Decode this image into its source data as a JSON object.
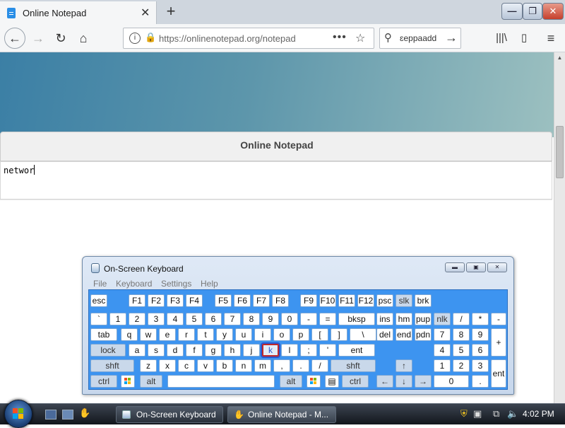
{
  "browser": {
    "tab_title": "Online Notepad",
    "tab_close": "✕",
    "new_tab": "+",
    "window_controls": {
      "minimize": "—",
      "maximize": "❐",
      "close": "✕"
    },
    "nav": {
      "back": "←",
      "forward": "→",
      "reload": "↻",
      "home": "⌂"
    },
    "url": "https://onlinenotepad.org/notepad",
    "url_info": "i",
    "url_lock": "🔒",
    "url_more": "•••",
    "url_star": "☆",
    "search_text": "ɛeppaadd",
    "search_icon": "⚲",
    "search_go": "→",
    "library": "|||\\",
    "sidebar_toggle": "▯",
    "menu": "≡"
  },
  "page": {
    "card_title": "Online Notepad",
    "editor_text": "networ"
  },
  "osk": {
    "title": "On-Screen Keyboard",
    "menu": [
      "File",
      "Keyboard",
      "Settings",
      "Help"
    ],
    "controls": {
      "minimize": "▬",
      "restore": "▣",
      "close": "✕"
    },
    "pressed_key": "k",
    "keys": [
      {
        "label": "esc",
        "special": false
      },
      {
        "label": "F1",
        "special": false
      },
      {
        "label": "F2",
        "special": false
      },
      {
        "label": "F3",
        "special": false
      },
      {
        "label": "F4",
        "special": false
      },
      {
        "label": "F5",
        "special": false
      },
      {
        "label": "F6",
        "special": false
      },
      {
        "label": "F7",
        "special": false
      },
      {
        "label": "F8",
        "special": false
      },
      {
        "label": "F9",
        "special": false
      },
      {
        "label": "F10",
        "special": false
      },
      {
        "label": "F11",
        "special": false
      },
      {
        "label": "F12",
        "special": false
      },
      {
        "label": "psc",
        "special": false
      },
      {
        "label": "slk",
        "special": true
      },
      {
        "label": "brk",
        "special": false
      },
      {
        "label": "`",
        "special": false
      },
      {
        "label": "1",
        "special": false
      },
      {
        "label": "2",
        "special": false
      },
      {
        "label": "3",
        "special": false
      },
      {
        "label": "4",
        "special": false
      },
      {
        "label": "5",
        "special": false
      },
      {
        "label": "6",
        "special": false
      },
      {
        "label": "7",
        "special": false
      },
      {
        "label": "8",
        "special": false
      },
      {
        "label": "9",
        "special": false
      },
      {
        "label": "0",
        "special": false
      },
      {
        "label": "-",
        "special": false
      },
      {
        "label": "=",
        "special": false
      },
      {
        "label": "bksp",
        "special": false
      },
      {
        "label": "ins",
        "special": false
      },
      {
        "label": "hm",
        "special": false
      },
      {
        "label": "pup",
        "special": false
      },
      {
        "label": "nlk",
        "special": true
      },
      {
        "label": "/",
        "special": false
      },
      {
        "label": "*",
        "special": false
      },
      {
        "label": "-",
        "special": false
      },
      {
        "label": "tab",
        "special": false
      },
      {
        "label": "q",
        "special": false
      },
      {
        "label": "w",
        "special": false
      },
      {
        "label": "e",
        "special": false
      },
      {
        "label": "r",
        "special": false
      },
      {
        "label": "t",
        "special": false
      },
      {
        "label": "y",
        "special": false
      },
      {
        "label": "u",
        "special": false
      },
      {
        "label": "i",
        "special": false
      },
      {
        "label": "o",
        "special": false
      },
      {
        "label": "p",
        "special": false
      },
      {
        "label": "[",
        "special": false
      },
      {
        "label": "]",
        "special": false
      },
      {
        "label": "\\",
        "special": false
      },
      {
        "label": "del",
        "special": false
      },
      {
        "label": "end",
        "special": false
      },
      {
        "label": "pdn",
        "special": false
      },
      {
        "label": "7",
        "special": false
      },
      {
        "label": "8",
        "special": false
      },
      {
        "label": "9",
        "special": false
      },
      {
        "label": "+",
        "special": false
      },
      {
        "label": "lock",
        "special": true
      },
      {
        "label": "a",
        "special": false
      },
      {
        "label": "s",
        "special": false
      },
      {
        "label": "d",
        "special": false
      },
      {
        "label": "f",
        "special": false
      },
      {
        "label": "g",
        "special": false
      },
      {
        "label": "h",
        "special": false
      },
      {
        "label": "j",
        "special": false
      },
      {
        "label": "k",
        "special": false
      },
      {
        "label": "l",
        "special": false
      },
      {
        "label": ";",
        "special": false
      },
      {
        "label": "'",
        "special": false
      },
      {
        "label": "ent",
        "special": false
      },
      {
        "label": "4",
        "special": false
      },
      {
        "label": "5",
        "special": false
      },
      {
        "label": "6",
        "special": false
      },
      {
        "label": "shft",
        "special": true
      },
      {
        "label": "z",
        "special": false
      },
      {
        "label": "x",
        "special": false
      },
      {
        "label": "c",
        "special": false
      },
      {
        "label": "v",
        "special": false
      },
      {
        "label": "b",
        "special": false
      },
      {
        "label": "n",
        "special": false
      },
      {
        "label": "m",
        "special": false
      },
      {
        "label": ",",
        "special": false
      },
      {
        "label": ".",
        "special": false
      },
      {
        "label": "/",
        "special": false
      },
      {
        "label": "shft",
        "special": true
      },
      {
        "label": "↑",
        "special": true
      },
      {
        "label": "1",
        "special": false
      },
      {
        "label": "2",
        "special": false
      },
      {
        "label": "3",
        "special": false
      },
      {
        "label": "ent",
        "special": false
      },
      {
        "label": "ctrl",
        "special": true
      },
      {
        "label": "",
        "special": false
      },
      {
        "label": "alt",
        "special": true
      },
      {
        "label": "",
        "special": false
      },
      {
        "label": "alt",
        "special": true
      },
      {
        "label": "",
        "special": false
      },
      {
        "label": "▤",
        "special": false
      },
      {
        "label": "ctrl",
        "special": true
      },
      {
        "label": "←",
        "special": true
      },
      {
        "label": "↓",
        "special": true
      },
      {
        "label": "→",
        "special": true
      },
      {
        "label": "0",
        "special": false
      },
      {
        "label": ".",
        "special": false
      }
    ]
  },
  "taskbar": {
    "items": [
      {
        "label": "On-Screen Keyboard"
      },
      {
        "label": "Online Notepad - M..."
      }
    ],
    "quicklaunch_3": "✋",
    "tray": {
      "shield": "⛨",
      "net": "▣",
      "monitor": "⧉",
      "volume": "🔈"
    },
    "clock": "4:02 PM"
  },
  "colors": {
    "osk_key_area": "#3d94f0",
    "pressed_key_border": "#c0282a",
    "hero_start": "#3b7fa5",
    "hero_end": "#9cc0c0"
  }
}
